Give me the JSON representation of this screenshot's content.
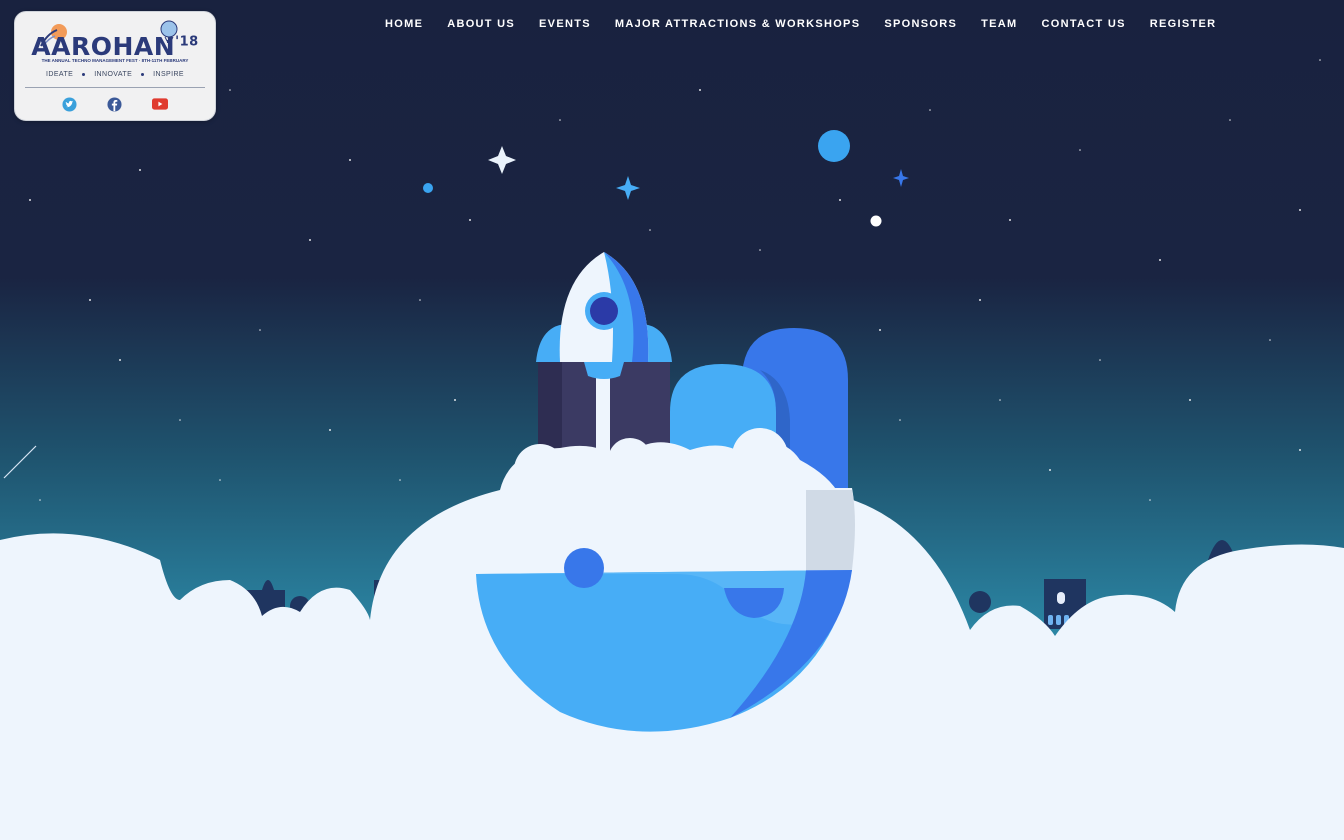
{
  "brand": {
    "name": "AAROHAN",
    "year_suffix": "'18",
    "subtitle": "THE ANNUAL TECHNO MANAGEMENT FEST · 8TH-11TH FEBRUARY",
    "tagline": [
      "IDEATE",
      "INNOVATE",
      "INSPIRE"
    ]
  },
  "nav": {
    "items": [
      {
        "label": "HOME"
      },
      {
        "label": "ABOUT US"
      },
      {
        "label": "EVENTS"
      },
      {
        "label": "MAJOR ATTRACTIONS & WORKSHOPS"
      },
      {
        "label": "SPONSORS"
      },
      {
        "label": "TEAM"
      },
      {
        "label": "CONTACT US"
      },
      {
        "label": "REGISTER"
      }
    ]
  },
  "socials": [
    {
      "icon": "twitter-icon",
      "color": "#3aa0db"
    },
    {
      "icon": "facebook-icon",
      "color": "#3b5998"
    },
    {
      "icon": "youtube-icon",
      "color": "#e03b2f"
    }
  ],
  "colors": {
    "sky_top": "#19223f",
    "sky_bottom": "#2b85a3",
    "cloud": "#eef5fd",
    "accent_blue": "#47adf6",
    "deep_blue": "#3877ea"
  }
}
